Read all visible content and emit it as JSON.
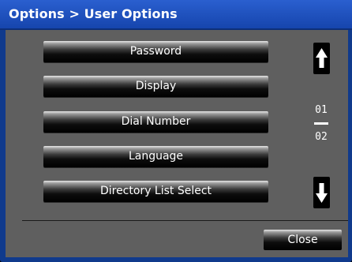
{
  "window": {
    "title": "Options > User Options"
  },
  "menu": {
    "items": [
      {
        "label": "Password"
      },
      {
        "label": "Display"
      },
      {
        "label": "Dial Number"
      },
      {
        "label": "Language"
      },
      {
        "label": "Directory List Select"
      }
    ]
  },
  "pager": {
    "current": "01",
    "total": "02",
    "up_icon": "arrow-up-icon",
    "down_icon": "arrow-down-icon"
  },
  "footer": {
    "close_label": "Close"
  },
  "colors": {
    "title_bar": "#1645ad",
    "frame": "#103a8c",
    "panel": "#5f5f5f",
    "button": "#000000",
    "text": "#ffffff"
  }
}
